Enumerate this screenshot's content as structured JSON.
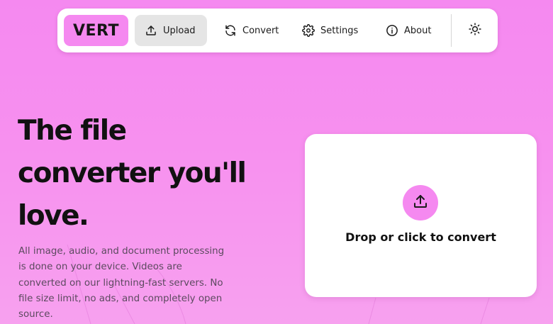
{
  "brand": {
    "logo_text": "VERT",
    "accent_color": "#f589f0"
  },
  "nav": {
    "items": [
      {
        "label": "Upload",
        "icon": "upload-icon",
        "active": true
      },
      {
        "label": "Convert",
        "icon": "refresh-icon",
        "active": false
      },
      {
        "label": "Settings",
        "icon": "gear-icon",
        "active": false
      },
      {
        "label": "About",
        "icon": "info-icon",
        "active": false
      }
    ],
    "theme_toggle_icon": "sun-icon"
  },
  "hero": {
    "title_lines": [
      "The file",
      "converter you'll",
      "love."
    ],
    "description_lines": [
      "All image, audio, and document processing",
      "is done on your device. Videos are",
      "converted on our lightning-fast servers. No",
      "file size limit, no ads, and completely open",
      "source."
    ]
  },
  "dropzone": {
    "label": "Drop or click to convert",
    "icon": "upload-icon"
  }
}
